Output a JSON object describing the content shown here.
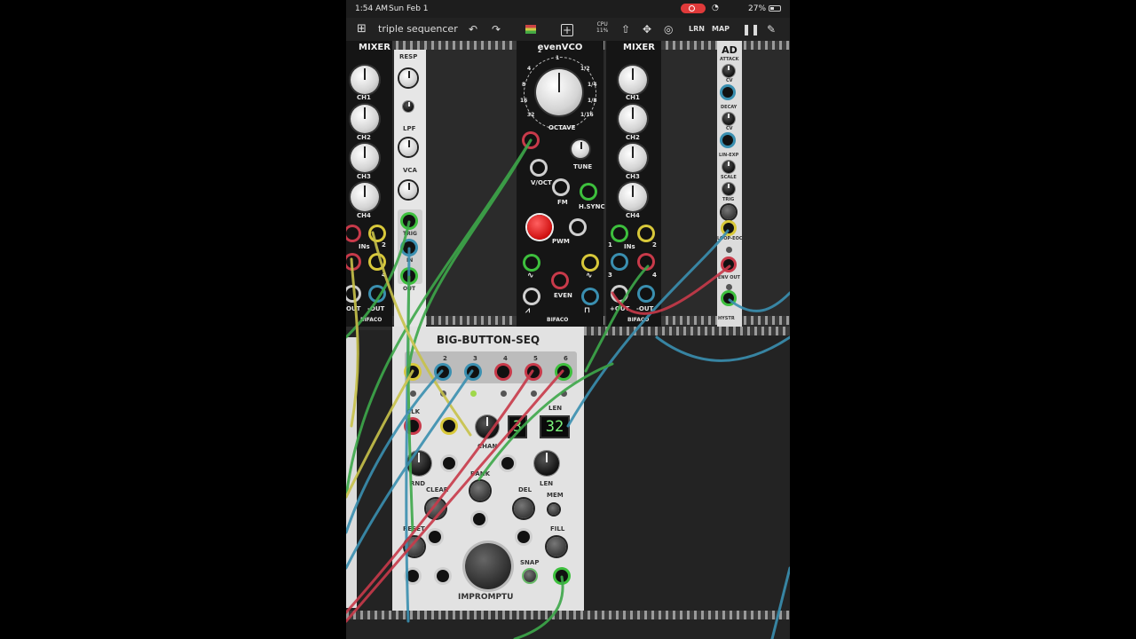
{
  "status_bar": {
    "time": "1:54 AM",
    "date": "Sun Feb 1",
    "battery": "27%"
  },
  "toolbar": {
    "patch_title": "triple sequencer",
    "cpu_label": "CPU",
    "cpu_value": "11%",
    "learn_label": "LRN",
    "map_label": "MAP"
  },
  "mixer_left": {
    "title": "MIXER",
    "channels": [
      "CH1",
      "CH2",
      "CH3",
      "CH4"
    ],
    "ins_label": "INs",
    "out_label": "OUT",
    "neg_out_label": "-OUT",
    "ins_nums": [
      "2",
      "4"
    ],
    "brand": "BIFACO"
  },
  "filter": {
    "labels": [
      "RESP",
      "LPF",
      "VCA",
      "TRIG",
      "IN",
      "OUT"
    ]
  },
  "vco": {
    "title": "evenVCO",
    "octave_label": "OCTAVE",
    "octave_marks": [
      "2",
      "1",
      "1/2",
      "1/4",
      "1/8",
      "1/16",
      "32",
      "16",
      "8",
      "4"
    ],
    "tune_label": "TUNE",
    "voct_label": "V/OCT",
    "fm_label": "FM",
    "hsync_label": "H.SYNC",
    "pwm_label": "PWM",
    "even_label": "EVEN",
    "brand": "BIFACO"
  },
  "mixer_right": {
    "title": "MIXER",
    "channels": [
      "CH1",
      "CH2",
      "CH3",
      "CH4"
    ],
    "ins_label": "INs",
    "ins_nums": [
      "1",
      "2",
      "3",
      "4"
    ],
    "out_label": "+OUT",
    "neg_out_label": "-OUT",
    "brand": "BIFACO"
  },
  "ad": {
    "title": "AD",
    "labels": [
      "ATTACK",
      "CV",
      "DECAY",
      "CV",
      "LIN-EXP",
      "SCALE",
      "TRIG",
      "LOOP-EOC",
      "ENV OUT",
      "HYSTR"
    ]
  },
  "bbs": {
    "title": "BIG-BUTTON-SEQ",
    "channel_nums": [
      "1",
      "2",
      "3",
      "4",
      "5",
      "6"
    ],
    "clk_label": "CLK",
    "chan_label": "CHAN",
    "len_top_label": "LEN",
    "chan_display": "3",
    "len_display": "32",
    "rnd_label": "RND",
    "len_label": "LEN",
    "bank_label": "BANK",
    "clear_label": "CLEAR",
    "del_label": "DEL",
    "mem_label": "MEM",
    "reset_label": "RESET",
    "fill_label": "FILL",
    "snap_label": "SNAP",
    "brand": "IMPROMPTU"
  }
}
